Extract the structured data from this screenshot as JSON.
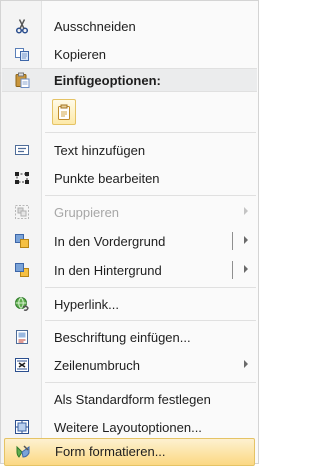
{
  "menu": {
    "cut": {
      "label": "Ausschneiden",
      "icon": "scissors-icon"
    },
    "copy": {
      "label": "Kopieren",
      "icon": "copy-icon"
    },
    "paste_header": {
      "label": "Einfügeoptionen:",
      "icon": "clipboard-icon"
    },
    "paste_option": {
      "icon": "paste-keep-formatting-icon"
    },
    "add_text": {
      "label": "Text hinzufügen",
      "icon": "text-box-icon"
    },
    "edit_points": {
      "label": "Punkte bearbeiten",
      "icon": "edit-points-icon"
    },
    "group": {
      "label": "Gruppieren",
      "icon": "group-icon",
      "disabled": true
    },
    "bring_front": {
      "label": "In den Vordergrund",
      "icon": "bring-to-front-icon"
    },
    "send_back": {
      "label": "In den Hintergrund",
      "icon": "send-to-back-icon"
    },
    "hyperlink": {
      "label": "Hyperlink...",
      "icon": "hyperlink-globe-icon"
    },
    "caption": {
      "label": "Beschriftung einfügen...",
      "icon": "insert-caption-icon"
    },
    "wrap": {
      "label": "Zeilenumbruch",
      "icon": "text-wrap-icon"
    },
    "default_shape": {
      "label": "Als Standardform festlegen"
    },
    "layout": {
      "label": "Weitere Layoutoptionen...",
      "icon": "layout-options-icon"
    },
    "format": {
      "label": "Form formatieren...",
      "icon": "format-shape-icon"
    }
  },
  "colors": {
    "highlight_top": "#fdf1d0",
    "highlight_bottom": "#fbd883",
    "highlight_border": "#e5c365",
    "disabled_text": "#a7a7a7"
  }
}
